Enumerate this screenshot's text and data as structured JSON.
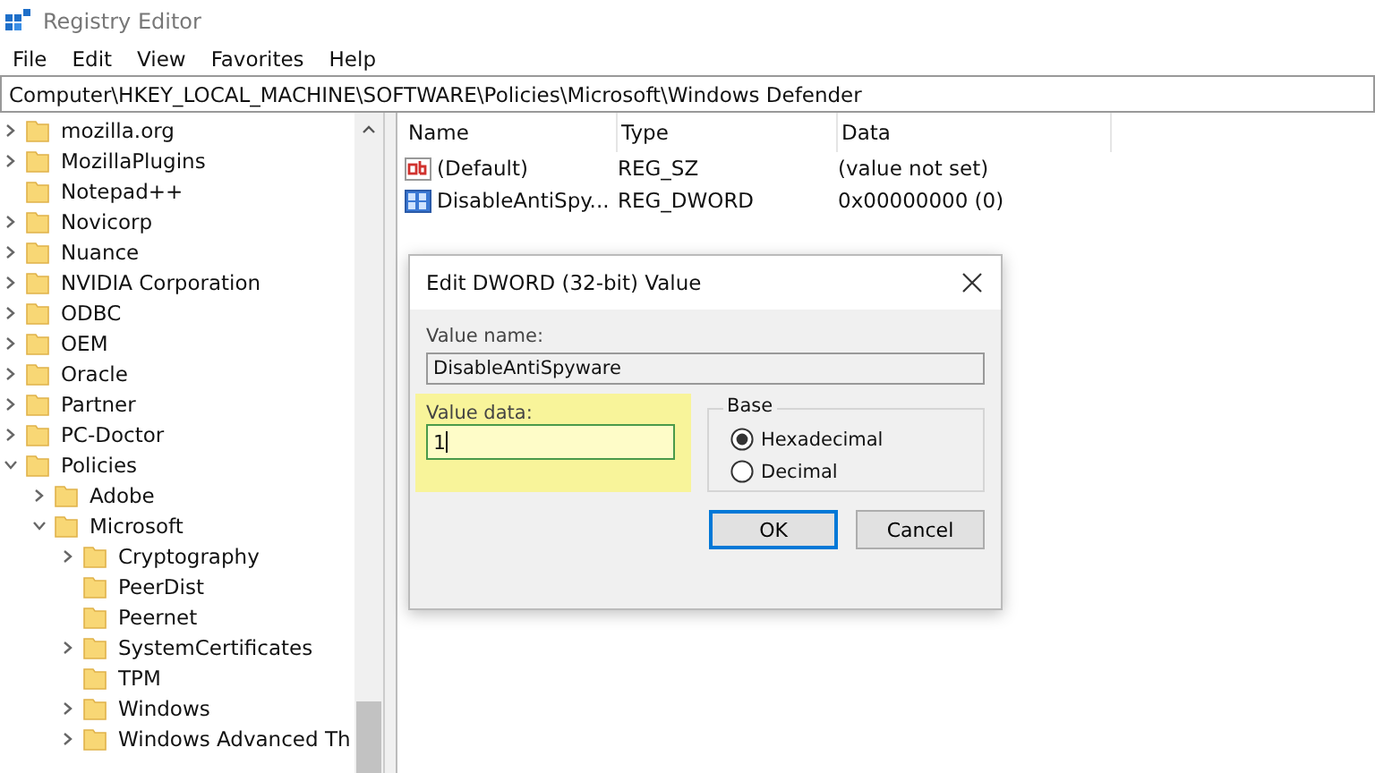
{
  "window": {
    "title": "Registry Editor"
  },
  "menu": [
    "File",
    "Edit",
    "View",
    "Favorites",
    "Help"
  ],
  "address": "Computer\\HKEY_LOCAL_MACHINE\\SOFTWARE\\Policies\\Microsoft\\Windows Defender",
  "tree": [
    {
      "label": "mozilla.org",
      "has_children": true,
      "expanded": false
    },
    {
      "label": "MozillaPlugins",
      "has_children": true,
      "expanded": false
    },
    {
      "label": "Notepad++",
      "has_children": false
    },
    {
      "label": "Novicorp",
      "has_children": true,
      "expanded": false
    },
    {
      "label": "Nuance",
      "has_children": true,
      "expanded": false
    },
    {
      "label": "NVIDIA Corporation",
      "has_children": true,
      "expanded": false
    },
    {
      "label": "ODBC",
      "has_children": true,
      "expanded": false
    },
    {
      "label": "OEM",
      "has_children": true,
      "expanded": false
    },
    {
      "label": "Oracle",
      "has_children": true,
      "expanded": false
    },
    {
      "label": "Partner",
      "has_children": true,
      "expanded": false
    },
    {
      "label": "PC-Doctor",
      "has_children": true,
      "expanded": false
    },
    {
      "label": "Policies",
      "has_children": true,
      "expanded": true,
      "children": [
        {
          "label": "Adobe",
          "has_children": true,
          "expanded": false
        },
        {
          "label": "Microsoft",
          "has_children": true,
          "expanded": true,
          "children": [
            {
              "label": "Cryptography",
              "has_children": true,
              "expanded": false
            },
            {
              "label": "PeerDist",
              "has_children": false
            },
            {
              "label": "Peernet",
              "has_children": false
            },
            {
              "label": "SystemCertificates",
              "has_children": true,
              "expanded": false
            },
            {
              "label": "TPM",
              "has_children": false
            },
            {
              "label": "Windows",
              "has_children": true,
              "expanded": false
            },
            {
              "label": "Windows Advanced Th",
              "has_children": true,
              "expanded": false
            }
          ]
        }
      ]
    }
  ],
  "values": {
    "columns": [
      "Name",
      "Type",
      "Data"
    ],
    "rows": [
      {
        "kind": "string",
        "name": "(Default)",
        "type": "REG_SZ",
        "data": "(value not set)"
      },
      {
        "kind": "binary",
        "name": "DisableAntiSpy...",
        "type": "REG_DWORD",
        "data": "0x00000000 (0)"
      }
    ]
  },
  "dialog": {
    "title": "Edit DWORD (32-bit) Value",
    "name_label": "Value name:",
    "name_value": "DisableAntiSpyware",
    "data_label": "Value data:",
    "data_value": "1",
    "data_highlighted": true,
    "base_label": "Base",
    "base_options": [
      {
        "label": "Hexadecimal",
        "selected": true
      },
      {
        "label": "Decimal",
        "selected": false
      }
    ],
    "buttons": [
      {
        "label": "OK",
        "default": true
      },
      {
        "label": "Cancel",
        "default": false
      }
    ]
  }
}
